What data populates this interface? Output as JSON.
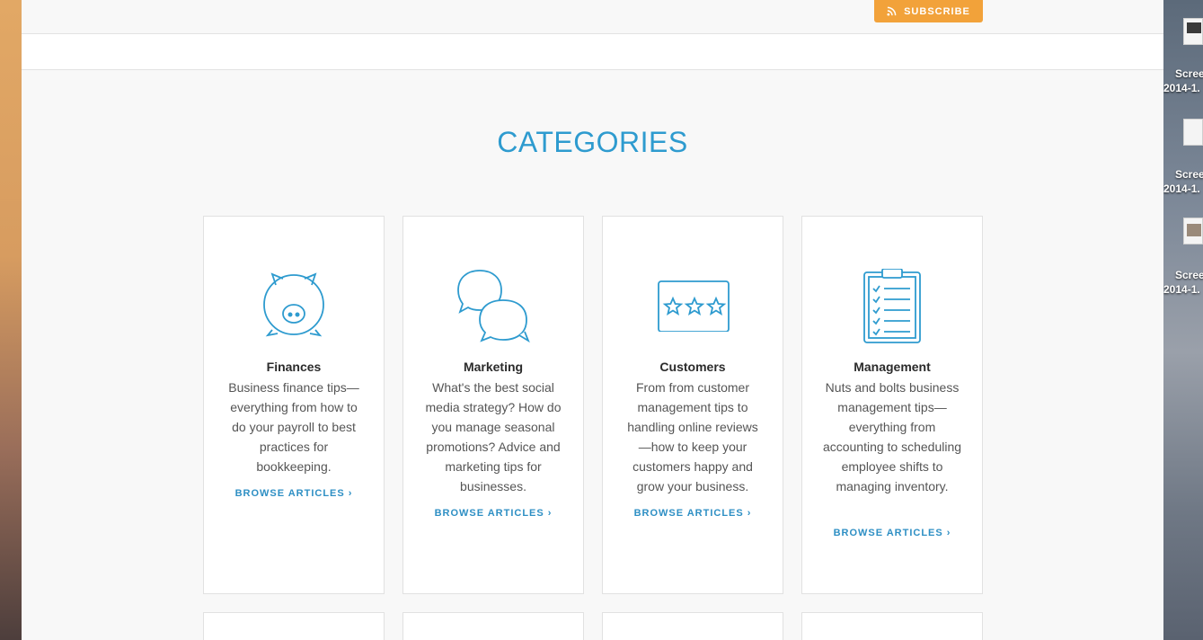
{
  "header": {
    "subscribe_label": "SUBSCRIBE"
  },
  "main": {
    "title": "CATEGORIES",
    "categories": [
      {
        "icon": "piggy-bank-icon",
        "title": "Finances",
        "description": "Business finance tips—everything from how to do your payroll to best practices for bookkeeping.",
        "link": "BROWSE ARTICLES ›"
      },
      {
        "icon": "chat-bubbles-icon",
        "title": "Marketing",
        "description": "What's the best social media strategy? How do you manage seasonal promotions? Advice and marketing tips for businesses.",
        "link": "BROWSE ARTICLES ›"
      },
      {
        "icon": "stars-rating-icon",
        "title": "Customers",
        "description": "From from customer management tips to handling online reviews—how to keep your customers happy and grow your business.",
        "link": "BROWSE ARTICLES ›"
      },
      {
        "icon": "clipboard-checklist-icon",
        "title": "Management",
        "description": "Nuts and bolts business management tips—everything from accounting to scheduling employee shifts to managing inventory.",
        "link": "BROWSE ARTICLES ›"
      }
    ]
  },
  "desktop": {
    "files": [
      {
        "line1": "Scree",
        "line2": "2014-1."
      },
      {
        "line1": "Scree",
        "line2": "2014-1."
      },
      {
        "line1": "Scree",
        "line2": "2014-1."
      }
    ]
  },
  "colors": {
    "accent": "#2e9bcf",
    "subscribe": "#f2a23a",
    "link": "#2e8fc4"
  }
}
